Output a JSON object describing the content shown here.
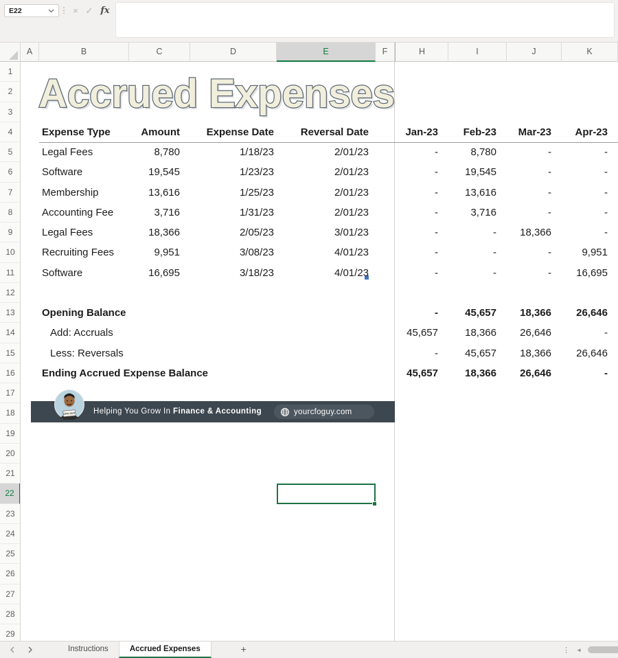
{
  "toolbar": {
    "cell_ref": "E22",
    "formula_value": "",
    "separator_glyph": "⋮",
    "cancel_glyph": "×",
    "enter_glyph": "✓",
    "fx_glyph": "fx"
  },
  "columns": {
    "letters": [
      "A",
      "B",
      "C",
      "D",
      "E",
      "F",
      "H",
      "I",
      "J",
      "K"
    ],
    "selected": "E"
  },
  "rows": {
    "numbers": [
      1,
      2,
      3,
      4,
      5,
      6,
      7,
      8,
      9,
      10,
      11,
      12,
      13,
      14,
      15,
      16,
      17,
      18,
      19,
      20,
      21,
      22,
      23,
      24,
      25,
      26,
      27,
      28,
      29
    ],
    "selected": 22
  },
  "sheet": {
    "title": "Accrued Expenses",
    "table_headers": {
      "expense_type": "Expense Type",
      "amount": "Amount",
      "expense_date": "Expense Date",
      "reversal_date": "Reversal Date"
    },
    "month_headers": [
      "Jan-23",
      "Feb-23",
      "Mar-23",
      "Apr-23"
    ],
    "expense_rows": [
      {
        "row": 5,
        "type": "Legal Fees",
        "amount": "8,780",
        "expense_date": "1/18/23",
        "reversal_date": "2/01/23",
        "months": [
          "-",
          "8,780",
          "-",
          "-"
        ]
      },
      {
        "row": 6,
        "type": "Software",
        "amount": "19,545",
        "expense_date": "1/23/23",
        "reversal_date": "2/01/23",
        "months": [
          "-",
          "19,545",
          "-",
          "-"
        ]
      },
      {
        "row": 7,
        "type": "Membership",
        "amount": "13,616",
        "expense_date": "1/25/23",
        "reversal_date": "2/01/23",
        "months": [
          "-",
          "13,616",
          "-",
          "-"
        ]
      },
      {
        "row": 8,
        "type": "Accounting Fee",
        "amount": "3,716",
        "expense_date": "1/31/23",
        "reversal_date": "2/01/23",
        "months": [
          "-",
          "3,716",
          "-",
          "-"
        ]
      },
      {
        "row": 9,
        "type": "Legal Fees",
        "amount": "18,366",
        "expense_date": "2/05/23",
        "reversal_date": "3/01/23",
        "months": [
          "-",
          "-",
          "18,366",
          "-"
        ]
      },
      {
        "row": 10,
        "type": "Recruiting Fees",
        "amount": "9,951",
        "expense_date": "3/08/23",
        "reversal_date": "4/01/23",
        "months": [
          "-",
          "-",
          "-",
          "9,951"
        ]
      },
      {
        "row": 11,
        "type": "Software",
        "amount": "16,695",
        "expense_date": "3/18/23",
        "reversal_date": "4/01/23",
        "months": [
          "-",
          "-",
          "-",
          "16,695"
        ]
      }
    ],
    "summary_rows": [
      {
        "row": 13,
        "label": "Opening Balance",
        "bold": true,
        "indent": false,
        "months": [
          "-",
          "45,657",
          "18,366",
          "26,646"
        ]
      },
      {
        "row": 14,
        "label": "Add: Accruals",
        "bold": false,
        "indent": true,
        "months": [
          "45,657",
          "18,366",
          "26,646",
          "-"
        ]
      },
      {
        "row": 15,
        "label": "Less: Reversals",
        "bold": false,
        "indent": true,
        "months": [
          "-",
          "45,657",
          "18,366",
          "26,646"
        ]
      },
      {
        "row": 16,
        "label": "Ending Accrued Expense Balance",
        "bold": true,
        "indent": false,
        "months": [
          "45,657",
          "18,366",
          "26,646",
          "-"
        ]
      }
    ]
  },
  "banner": {
    "text_prefix": "Helping You Grow In ",
    "text_bold": "Finance & Accounting",
    "website": "yourcfoguy.com",
    "avatar_tag": "CFO GUY"
  },
  "tabbar": {
    "tabs": [
      {
        "label": "Instructions",
        "active": false
      },
      {
        "label": "Accrued Expenses",
        "active": true
      }
    ],
    "add_button": "+",
    "overflow_glyph": "⋮",
    "scroll_left_glyph": "◄"
  },
  "colors": {
    "accent_green": "#117c44",
    "selection_green": "#1e7145",
    "banner_bg": "#3d4750",
    "title_fill": "#f1efdc",
    "title_outline": "#5d6874",
    "edit_flag_blue": "#4472c4"
  }
}
